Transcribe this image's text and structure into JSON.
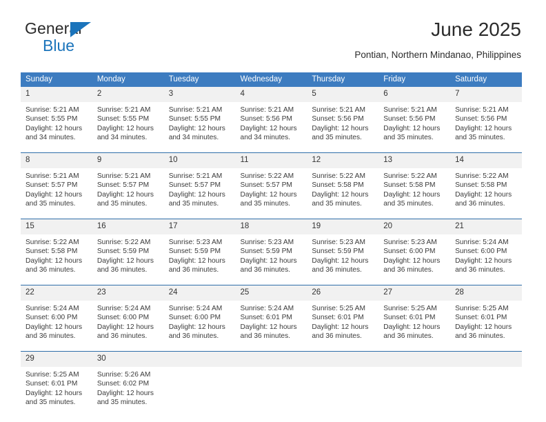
{
  "brand": {
    "name_top": "General",
    "name_bottom": "Blue",
    "accent_color": "#1b74bb"
  },
  "header": {
    "title": "June 2025",
    "subtitle": "Pontian, Northern Mindanao, Philippines"
  },
  "theme": {
    "header_bg": "#3d7cc0",
    "header_text": "#ffffff",
    "daynum_bg": "#f1f1f1",
    "row_rule": "#2e6da8"
  },
  "weekdays": [
    "Sunday",
    "Monday",
    "Tuesday",
    "Wednesday",
    "Thursday",
    "Friday",
    "Saturday"
  ],
  "labels": {
    "sunrise_prefix": "Sunrise:",
    "sunset_prefix": "Sunset:",
    "daylight_prefix": "Daylight:"
  },
  "weeks": [
    [
      {
        "day": "1",
        "sunrise": "Sunrise: 5:21 AM",
        "sunset": "Sunset: 5:55 PM",
        "daylight1": "Daylight: 12 hours",
        "daylight2": "and 34 minutes."
      },
      {
        "day": "2",
        "sunrise": "Sunrise: 5:21 AM",
        "sunset": "Sunset: 5:55 PM",
        "daylight1": "Daylight: 12 hours",
        "daylight2": "and 34 minutes."
      },
      {
        "day": "3",
        "sunrise": "Sunrise: 5:21 AM",
        "sunset": "Sunset: 5:55 PM",
        "daylight1": "Daylight: 12 hours",
        "daylight2": "and 34 minutes."
      },
      {
        "day": "4",
        "sunrise": "Sunrise: 5:21 AM",
        "sunset": "Sunset: 5:56 PM",
        "daylight1": "Daylight: 12 hours",
        "daylight2": "and 34 minutes."
      },
      {
        "day": "5",
        "sunrise": "Sunrise: 5:21 AM",
        "sunset": "Sunset: 5:56 PM",
        "daylight1": "Daylight: 12 hours",
        "daylight2": "and 35 minutes."
      },
      {
        "day": "6",
        "sunrise": "Sunrise: 5:21 AM",
        "sunset": "Sunset: 5:56 PM",
        "daylight1": "Daylight: 12 hours",
        "daylight2": "and 35 minutes."
      },
      {
        "day": "7",
        "sunrise": "Sunrise: 5:21 AM",
        "sunset": "Sunset: 5:56 PM",
        "daylight1": "Daylight: 12 hours",
        "daylight2": "and 35 minutes."
      }
    ],
    [
      {
        "day": "8",
        "sunrise": "Sunrise: 5:21 AM",
        "sunset": "Sunset: 5:57 PM",
        "daylight1": "Daylight: 12 hours",
        "daylight2": "and 35 minutes."
      },
      {
        "day": "9",
        "sunrise": "Sunrise: 5:21 AM",
        "sunset": "Sunset: 5:57 PM",
        "daylight1": "Daylight: 12 hours",
        "daylight2": "and 35 minutes."
      },
      {
        "day": "10",
        "sunrise": "Sunrise: 5:21 AM",
        "sunset": "Sunset: 5:57 PM",
        "daylight1": "Daylight: 12 hours",
        "daylight2": "and 35 minutes."
      },
      {
        "day": "11",
        "sunrise": "Sunrise: 5:22 AM",
        "sunset": "Sunset: 5:57 PM",
        "daylight1": "Daylight: 12 hours",
        "daylight2": "and 35 minutes."
      },
      {
        "day": "12",
        "sunrise": "Sunrise: 5:22 AM",
        "sunset": "Sunset: 5:58 PM",
        "daylight1": "Daylight: 12 hours",
        "daylight2": "and 35 minutes."
      },
      {
        "day": "13",
        "sunrise": "Sunrise: 5:22 AM",
        "sunset": "Sunset: 5:58 PM",
        "daylight1": "Daylight: 12 hours",
        "daylight2": "and 35 minutes."
      },
      {
        "day": "14",
        "sunrise": "Sunrise: 5:22 AM",
        "sunset": "Sunset: 5:58 PM",
        "daylight1": "Daylight: 12 hours",
        "daylight2": "and 36 minutes."
      }
    ],
    [
      {
        "day": "15",
        "sunrise": "Sunrise: 5:22 AM",
        "sunset": "Sunset: 5:58 PM",
        "daylight1": "Daylight: 12 hours",
        "daylight2": "and 36 minutes."
      },
      {
        "day": "16",
        "sunrise": "Sunrise: 5:22 AM",
        "sunset": "Sunset: 5:59 PM",
        "daylight1": "Daylight: 12 hours",
        "daylight2": "and 36 minutes."
      },
      {
        "day": "17",
        "sunrise": "Sunrise: 5:23 AM",
        "sunset": "Sunset: 5:59 PM",
        "daylight1": "Daylight: 12 hours",
        "daylight2": "and 36 minutes."
      },
      {
        "day": "18",
        "sunrise": "Sunrise: 5:23 AM",
        "sunset": "Sunset: 5:59 PM",
        "daylight1": "Daylight: 12 hours",
        "daylight2": "and 36 minutes."
      },
      {
        "day": "19",
        "sunrise": "Sunrise: 5:23 AM",
        "sunset": "Sunset: 5:59 PM",
        "daylight1": "Daylight: 12 hours",
        "daylight2": "and 36 minutes."
      },
      {
        "day": "20",
        "sunrise": "Sunrise: 5:23 AM",
        "sunset": "Sunset: 6:00 PM",
        "daylight1": "Daylight: 12 hours",
        "daylight2": "and 36 minutes."
      },
      {
        "day": "21",
        "sunrise": "Sunrise: 5:24 AM",
        "sunset": "Sunset: 6:00 PM",
        "daylight1": "Daylight: 12 hours",
        "daylight2": "and 36 minutes."
      }
    ],
    [
      {
        "day": "22",
        "sunrise": "Sunrise: 5:24 AM",
        "sunset": "Sunset: 6:00 PM",
        "daylight1": "Daylight: 12 hours",
        "daylight2": "and 36 minutes."
      },
      {
        "day": "23",
        "sunrise": "Sunrise: 5:24 AM",
        "sunset": "Sunset: 6:00 PM",
        "daylight1": "Daylight: 12 hours",
        "daylight2": "and 36 minutes."
      },
      {
        "day": "24",
        "sunrise": "Sunrise: 5:24 AM",
        "sunset": "Sunset: 6:00 PM",
        "daylight1": "Daylight: 12 hours",
        "daylight2": "and 36 minutes."
      },
      {
        "day": "25",
        "sunrise": "Sunrise: 5:24 AM",
        "sunset": "Sunset: 6:01 PM",
        "daylight1": "Daylight: 12 hours",
        "daylight2": "and 36 minutes."
      },
      {
        "day": "26",
        "sunrise": "Sunrise: 5:25 AM",
        "sunset": "Sunset: 6:01 PM",
        "daylight1": "Daylight: 12 hours",
        "daylight2": "and 36 minutes."
      },
      {
        "day": "27",
        "sunrise": "Sunrise: 5:25 AM",
        "sunset": "Sunset: 6:01 PM",
        "daylight1": "Daylight: 12 hours",
        "daylight2": "and 36 minutes."
      },
      {
        "day": "28",
        "sunrise": "Sunrise: 5:25 AM",
        "sunset": "Sunset: 6:01 PM",
        "daylight1": "Daylight: 12 hours",
        "daylight2": "and 36 minutes."
      }
    ],
    [
      {
        "day": "29",
        "sunrise": "Sunrise: 5:25 AM",
        "sunset": "Sunset: 6:01 PM",
        "daylight1": "Daylight: 12 hours",
        "daylight2": "and 35 minutes."
      },
      {
        "day": "30",
        "sunrise": "Sunrise: 5:26 AM",
        "sunset": "Sunset: 6:02 PM",
        "daylight1": "Daylight: 12 hours",
        "daylight2": "and 35 minutes."
      },
      {
        "day": "",
        "sunrise": "",
        "sunset": "",
        "daylight1": "",
        "daylight2": ""
      },
      {
        "day": "",
        "sunrise": "",
        "sunset": "",
        "daylight1": "",
        "daylight2": ""
      },
      {
        "day": "",
        "sunrise": "",
        "sunset": "",
        "daylight1": "",
        "daylight2": ""
      },
      {
        "day": "",
        "sunrise": "",
        "sunset": "",
        "daylight1": "",
        "daylight2": ""
      },
      {
        "day": "",
        "sunrise": "",
        "sunset": "",
        "daylight1": "",
        "daylight2": ""
      }
    ]
  ]
}
